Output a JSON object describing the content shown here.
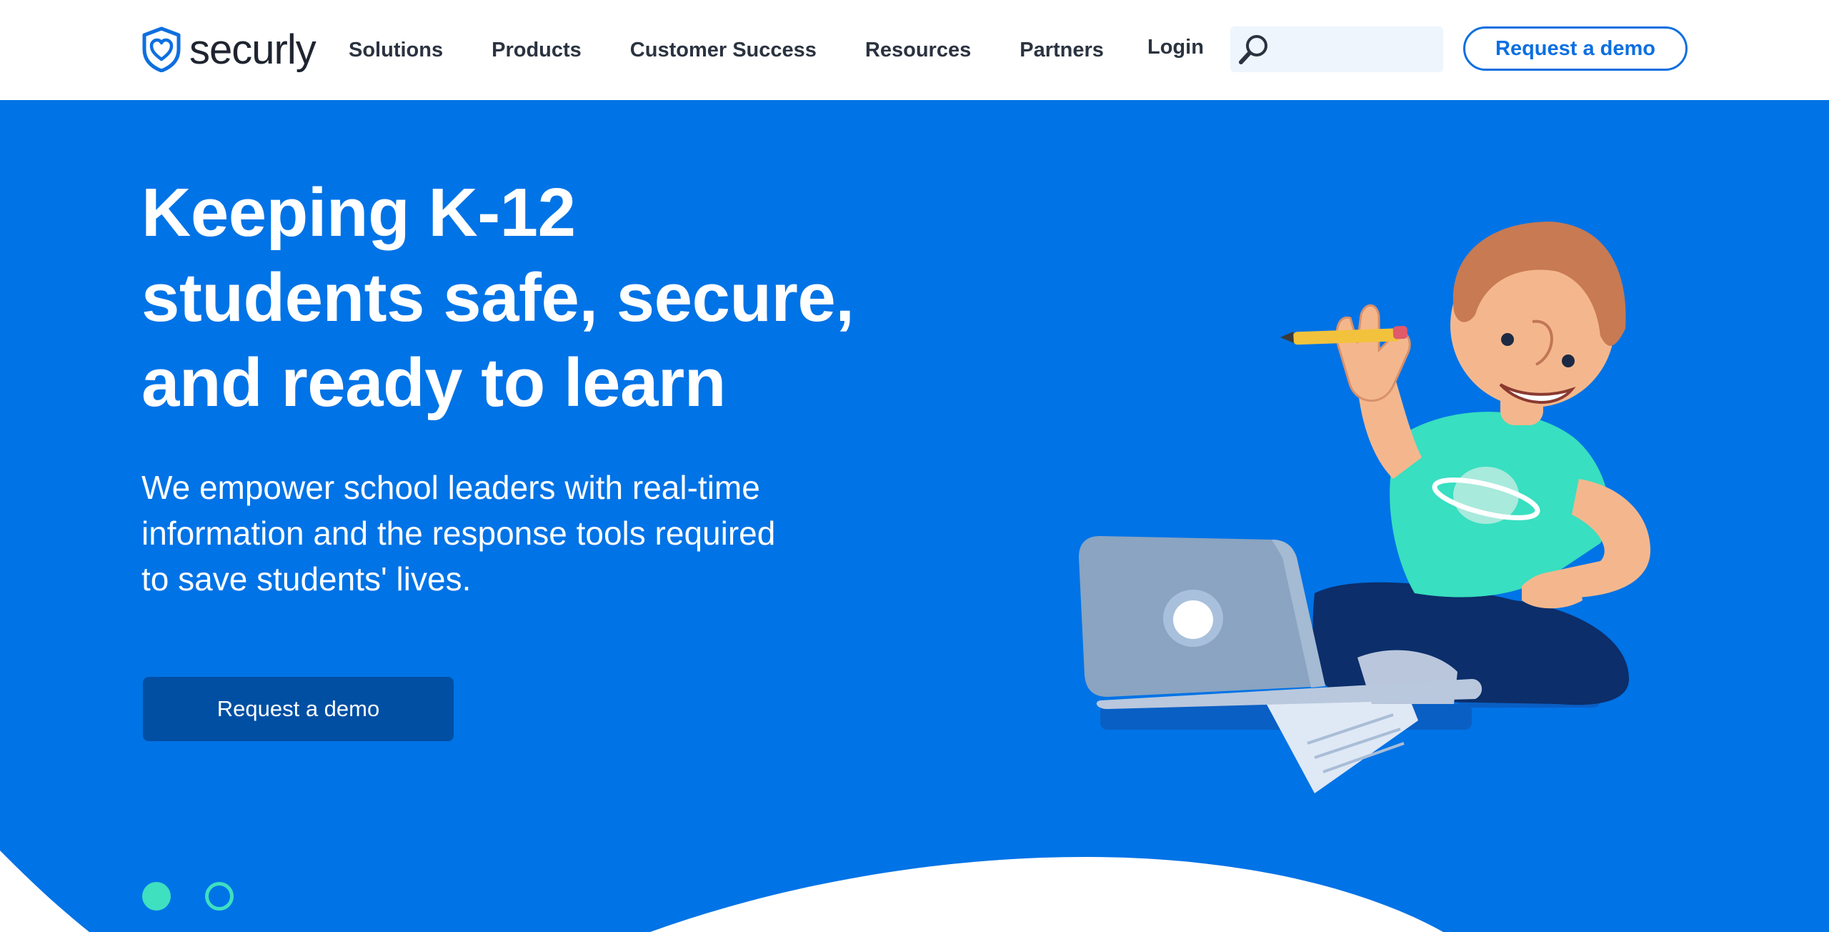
{
  "brand": {
    "name": "securly",
    "accent": "#0073e6",
    "dark_button": "#004fa3",
    "teal": "#3ee0c0"
  },
  "nav": {
    "items": [
      {
        "label": "Solutions"
      },
      {
        "label": "Products"
      },
      {
        "label": "Customer Success"
      },
      {
        "label": "Resources"
      },
      {
        "label": "Partners"
      }
    ],
    "login": "Login",
    "search_placeholder": "",
    "cta": "Request a demo"
  },
  "hero": {
    "title_lines": [
      "Keeping K-12",
      "students safe, secure,",
      "and ready to learn"
    ],
    "subtitle_lines": [
      "We empower school leaders with real-time",
      "information and the response tools required",
      "to save students' lives."
    ],
    "cta": "Request a demo",
    "carousel": {
      "slides": 2,
      "active": 1
    }
  },
  "icons": {
    "logo": "shield-heart-icon",
    "search": "search-icon",
    "illustration": "student-with-laptop-illustration"
  }
}
